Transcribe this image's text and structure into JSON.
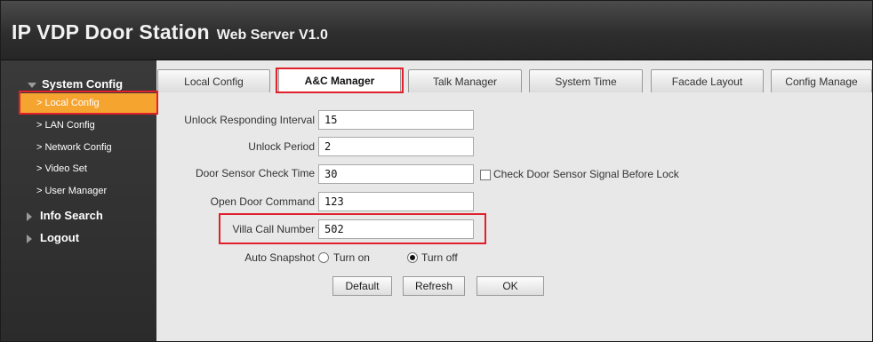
{
  "header": {
    "title": "IP VDP Door Station",
    "subtitle": "Web Server V1.0"
  },
  "sidebar": {
    "groups": [
      {
        "label": "System Config",
        "icon": "triangle-down-icon"
      },
      {
        "label": "Info Search",
        "icon": "triangle-right-icon"
      },
      {
        "label": "Logout",
        "icon": "triangle-right-icon"
      }
    ],
    "items": [
      {
        "label": "> Local Config",
        "active": true
      },
      {
        "label": "> LAN Config"
      },
      {
        "label": "> Network Config"
      },
      {
        "label": "> Video Set"
      },
      {
        "label": "> User Manager"
      }
    ]
  },
  "tabs": [
    {
      "label": "Local Config"
    },
    {
      "label": "A&C Manager",
      "active": true
    },
    {
      "label": "Talk Manager"
    },
    {
      "label": "System Time"
    },
    {
      "label": "Facade Layout"
    },
    {
      "label": "Config Manage"
    }
  ],
  "form": {
    "unlock_interval": {
      "label": "Unlock Responding Interval",
      "value": "15"
    },
    "unlock_period": {
      "label": "Unlock Period",
      "value": "2"
    },
    "door_sensor": {
      "label": "Door Sensor Check Time",
      "value": "30",
      "checkbox_label": "Check Door Sensor Signal Before Lock",
      "checked": false
    },
    "open_door": {
      "label": "Open Door Command",
      "value": "123"
    },
    "villa_call": {
      "label": "Villa Call Number",
      "value": "502"
    },
    "auto_snapshot": {
      "label": "Auto Snapshot",
      "option_on": "Turn on",
      "option_off": "Turn off",
      "selected": "Turn off"
    }
  },
  "buttons": {
    "default": "Default",
    "refresh": "Refresh",
    "ok": "OK"
  },
  "colors": {
    "active_item": "#f6a430",
    "highlight_box": "#e0202a",
    "header_bg": "#3a3a3a"
  }
}
